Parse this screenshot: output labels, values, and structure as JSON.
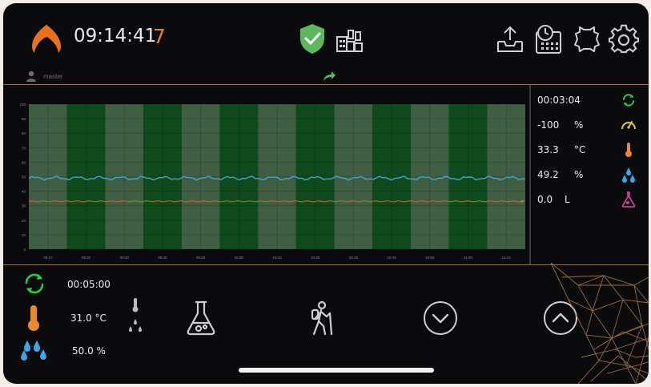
{
  "header": {
    "time": "09:14:41",
    "counter": "7",
    "icons": [
      "flame-logo-icon",
      "shield-check-icon",
      "plant-icon",
      "tray-upload-icon",
      "schedule-icon",
      "leather-hide-icon",
      "gear-icon"
    ]
  },
  "user": {
    "name": "master"
  },
  "chart_data": {
    "type": "line",
    "ylim": [
      0,
      100
    ],
    "y_ticks": [
      "100",
      "90",
      "80",
      "70",
      "60",
      "50",
      "40",
      "30",
      "20",
      "10",
      "0"
    ],
    "x_ticks": [
      "09:10",
      "09:20",
      "09:30",
      "09:40",
      "09:50",
      "10:00",
      "10:10",
      "10:20",
      "10:30",
      "10:40",
      "10:50",
      "11:00",
      "11:10"
    ],
    "background_bands": [
      "light",
      "dark",
      "light",
      "dark",
      "light",
      "dark",
      "light",
      "dark",
      "light",
      "dark",
      "light",
      "dark",
      "light"
    ],
    "series": [
      {
        "color": "#3ba7d8",
        "level": 49
      },
      {
        "color": "#d06a2a",
        "level": 33
      }
    ],
    "colors": {
      "band_dark": "#0e4a1b",
      "band_light": "#3f5e44",
      "grid": "#3a3a3a"
    }
  },
  "readings": [
    {
      "value": "00:03:04",
      "unit": "",
      "icon": "cycle-icon",
      "color": "#2ec84a"
    },
    {
      "value": "-100",
      "unit": "%",
      "icon": "speedometer-icon",
      "color": "#d8c84a"
    },
    {
      "value": "33.3",
      "unit": "°C",
      "icon": "thermometer-icon",
      "color": "#e98b2a"
    },
    {
      "value": "49.2",
      "unit": "%",
      "icon": "humidity-drops-icon",
      "color": "#3aa7e8"
    },
    {
      "value": "0.0",
      "unit": "L",
      "icon": "flask-icon",
      "color": "#c8439a"
    }
  ],
  "settings": {
    "cycle_time": "00:05:00",
    "temperature": "31.0 °C",
    "humidity": "50.0 %"
  },
  "controls": [
    "chemical-flask-icon",
    "hiker-icon",
    "chevron-down-circle-icon",
    "chevron-up-circle-icon"
  ],
  "colors": {
    "accent": "#e0803a",
    "divider": "#a86a3e",
    "background": "#0b0b0d"
  }
}
